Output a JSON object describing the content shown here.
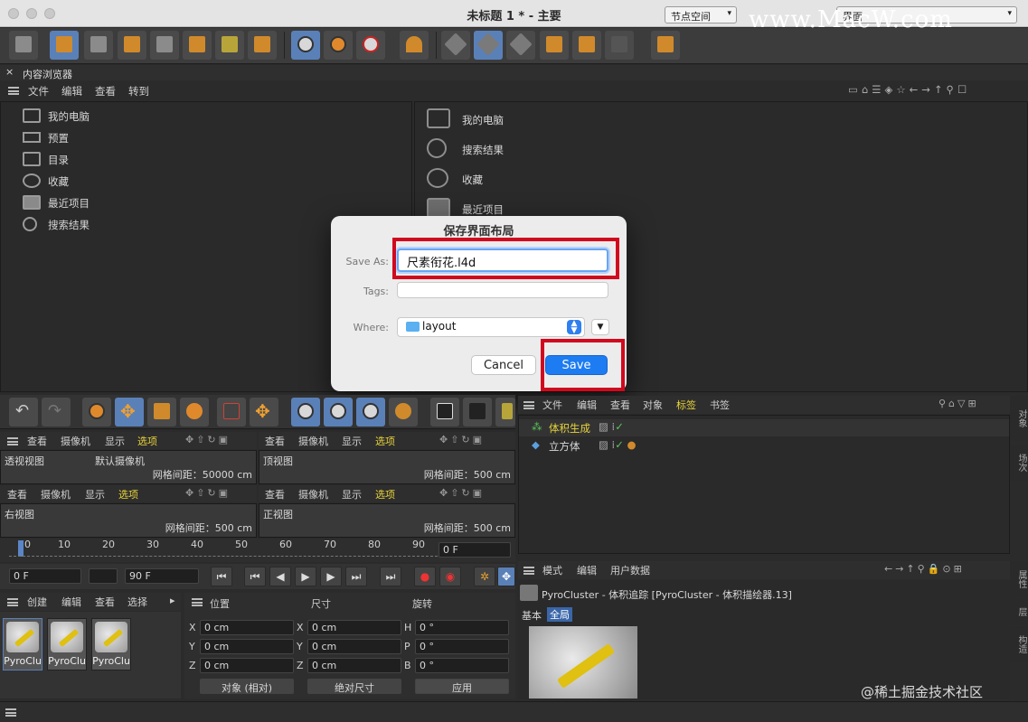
{
  "window": {
    "title": "未标题 1 * - 主要",
    "node_space_label": "节点空间",
    "layout_combo": "界面"
  },
  "watermark": "www.MacW.com",
  "content_browser": {
    "tab_title": "内容浏览器",
    "menu": [
      "文件",
      "编辑",
      "查看",
      "转到"
    ],
    "tree": [
      "我的电脑",
      "预置",
      "目录",
      "收藏",
      "最近项目",
      "搜索结果"
    ],
    "grid": [
      "我的电脑",
      "搜索结果",
      "收藏",
      "最近项目"
    ]
  },
  "dialog": {
    "title": "保存界面布局",
    "save_as_label": "Save As:",
    "save_as_value": "尺素衔花.l4d",
    "tags_label": "Tags:",
    "where_label": "Where:",
    "where_value": "layout",
    "cancel": "Cancel",
    "save": "Save"
  },
  "viewports": {
    "menu": [
      "查看",
      "摄像机",
      "显示",
      "选项"
    ],
    "top_left": {
      "name": "透视视图",
      "camera": "默认摄像机",
      "grid": "网格间距：50000 cm"
    },
    "top_right": {
      "name": "顶视图",
      "grid": "网格间距：500 cm"
    },
    "bottom_left": {
      "name": "右视图",
      "grid": "网格间距：500 cm"
    },
    "bottom_right": {
      "name": "正视图",
      "grid": "网格间距：500 cm"
    }
  },
  "timeline": {
    "ticks": [
      "0",
      "10",
      "20",
      "30",
      "40",
      "50",
      "60",
      "70",
      "80",
      "90"
    ],
    "current": "0 F",
    "start": "0 F",
    "end": "90 F"
  },
  "objects": {
    "menu": [
      "文件",
      "编辑",
      "查看",
      "对象",
      "标签",
      "书签"
    ],
    "items": [
      "体积生成",
      "立方体"
    ]
  },
  "materials": {
    "menu": [
      "创建",
      "编辑",
      "查看",
      "选择"
    ],
    "items": [
      "PyroClu",
      "PyroClu",
      "PyroClu"
    ]
  },
  "coordinates": {
    "headers": [
      "位置",
      "尺寸",
      "旋转"
    ],
    "rows": [
      {
        "a": "X",
        "av": "0 cm",
        "b": "X",
        "bv": "0 cm",
        "c": "H",
        "cv": "0 °"
      },
      {
        "a": "Y",
        "av": "0 cm",
        "b": "Y",
        "bv": "0 cm",
        "c": "P",
        "cv": "0 °"
      },
      {
        "a": "Z",
        "av": "0 cm",
        "b": "Z",
        "bv": "0 cm",
        "c": "B",
        "cv": "0 °"
      }
    ],
    "mode": "对象 (相对)",
    "size_mode": "绝对尺寸",
    "apply": "应用"
  },
  "attributes": {
    "menu": [
      "模式",
      "编辑",
      "用户数据"
    ],
    "title": "PyroCluster - 体积追踪 [PyroCluster - 体积描绘器.13]",
    "tabs": [
      "基本",
      "全局"
    ]
  },
  "side_tabs": {
    "right1": "对象",
    "right2": "场次",
    "right3": "属性",
    "right4": "层",
    "right5": "构造"
  },
  "credit": "@稀土掘金技术社区"
}
